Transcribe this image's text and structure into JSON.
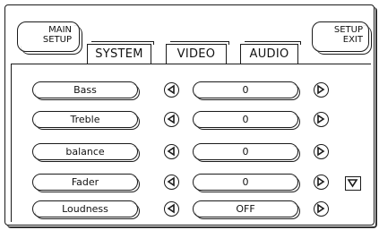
{
  "header": {
    "main_setup": [
      "MAIN",
      "SETUP"
    ],
    "setup_exit": [
      "SETUP",
      "EXIT"
    ]
  },
  "tabs": [
    {
      "label": "SYSTEM",
      "selected": false
    },
    {
      "label": "VIDEO",
      "selected": false
    },
    {
      "label": "AUDIO",
      "selected": true
    }
  ],
  "rows": [
    {
      "label": "Bass",
      "value": "0"
    },
    {
      "label": "Treble",
      "value": "0"
    },
    {
      "label": "balance",
      "value": "0"
    },
    {
      "label": "Fader",
      "value": "0"
    },
    {
      "label": "Loudness",
      "value": "OFF"
    }
  ],
  "icons": {
    "decrement": "triangle-left-icon",
    "increment": "triangle-right-icon",
    "scroll": "triangle-down-icon"
  }
}
